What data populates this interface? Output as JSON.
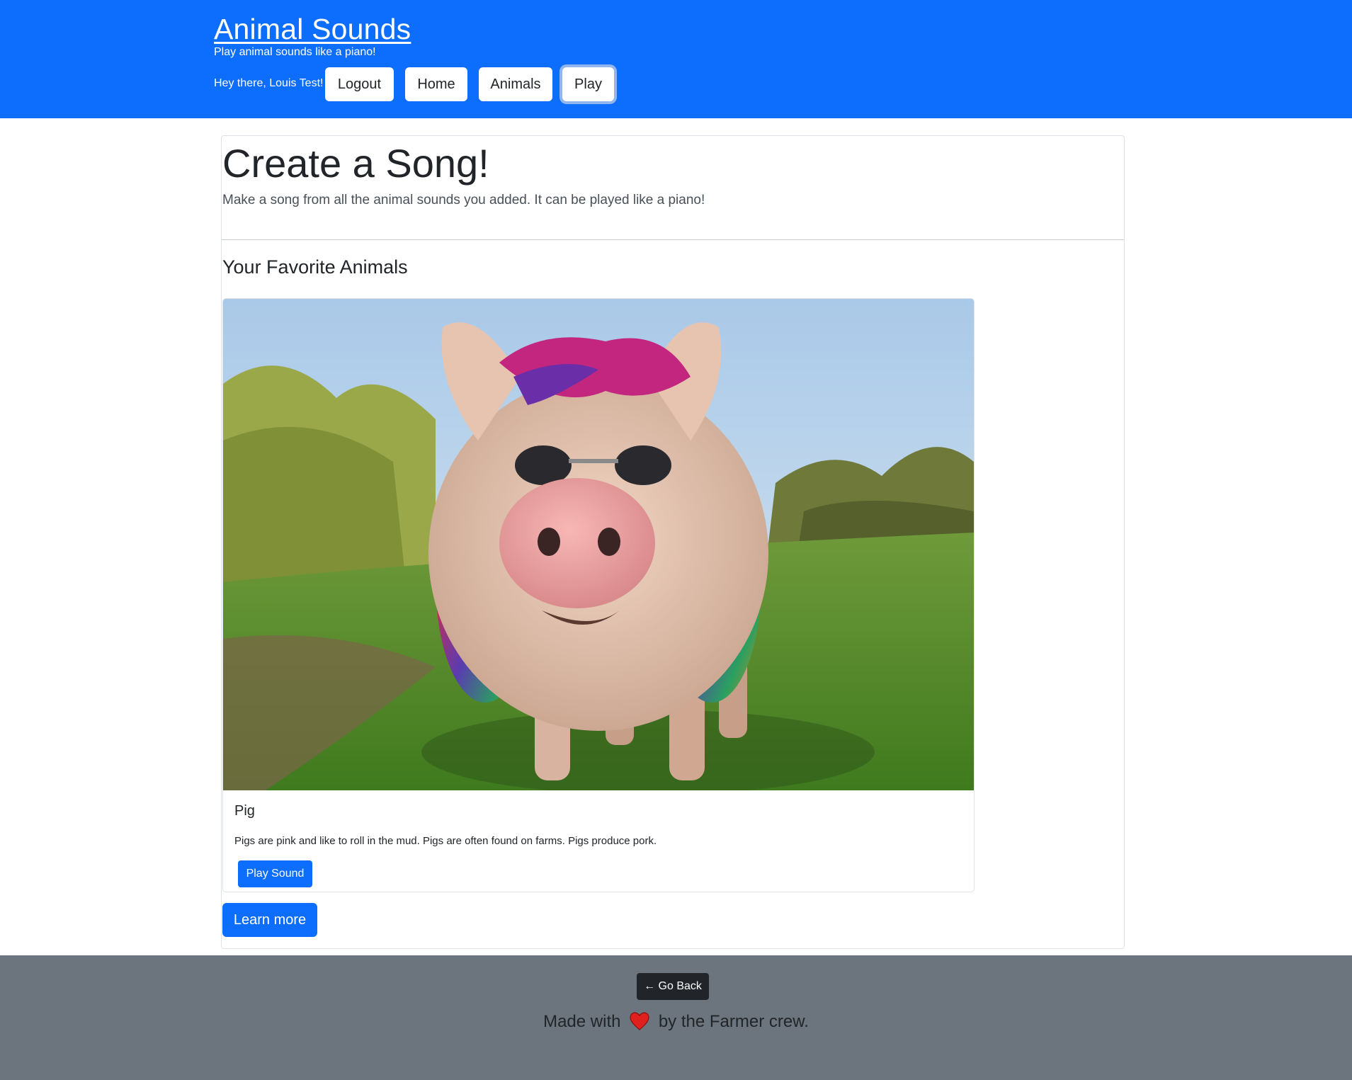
{
  "header": {
    "brand": "Animal Sounds",
    "tagline": "Play animal sounds like a piano!",
    "greeting": "Hey there, Louis Test!",
    "nav": {
      "logout": "Logout",
      "home": "Home",
      "animals": "Animals",
      "play": "Play"
    },
    "active_nav": "play",
    "brand_color": "#0d6efd"
  },
  "main": {
    "title": "Create a Song!",
    "subtitle": "Make a song from all the animal sounds you added. It can be played like a piano!",
    "section_title": "Your Favorite Animals",
    "animals": [
      {
        "name": "Pig",
        "description": "Pigs are pink and like to roll in the mud. Pigs are often found on farms. Pigs produce pork.",
        "button": "Play Sound",
        "image": "pig-photo"
      }
    ],
    "learn_more": "Learn more"
  },
  "footer": {
    "go_back": "← Go Back",
    "made_with": "Made with",
    "by_crew": "by the Farmer crew.",
    "heart": "heart-icon",
    "background": "#6c757d"
  }
}
